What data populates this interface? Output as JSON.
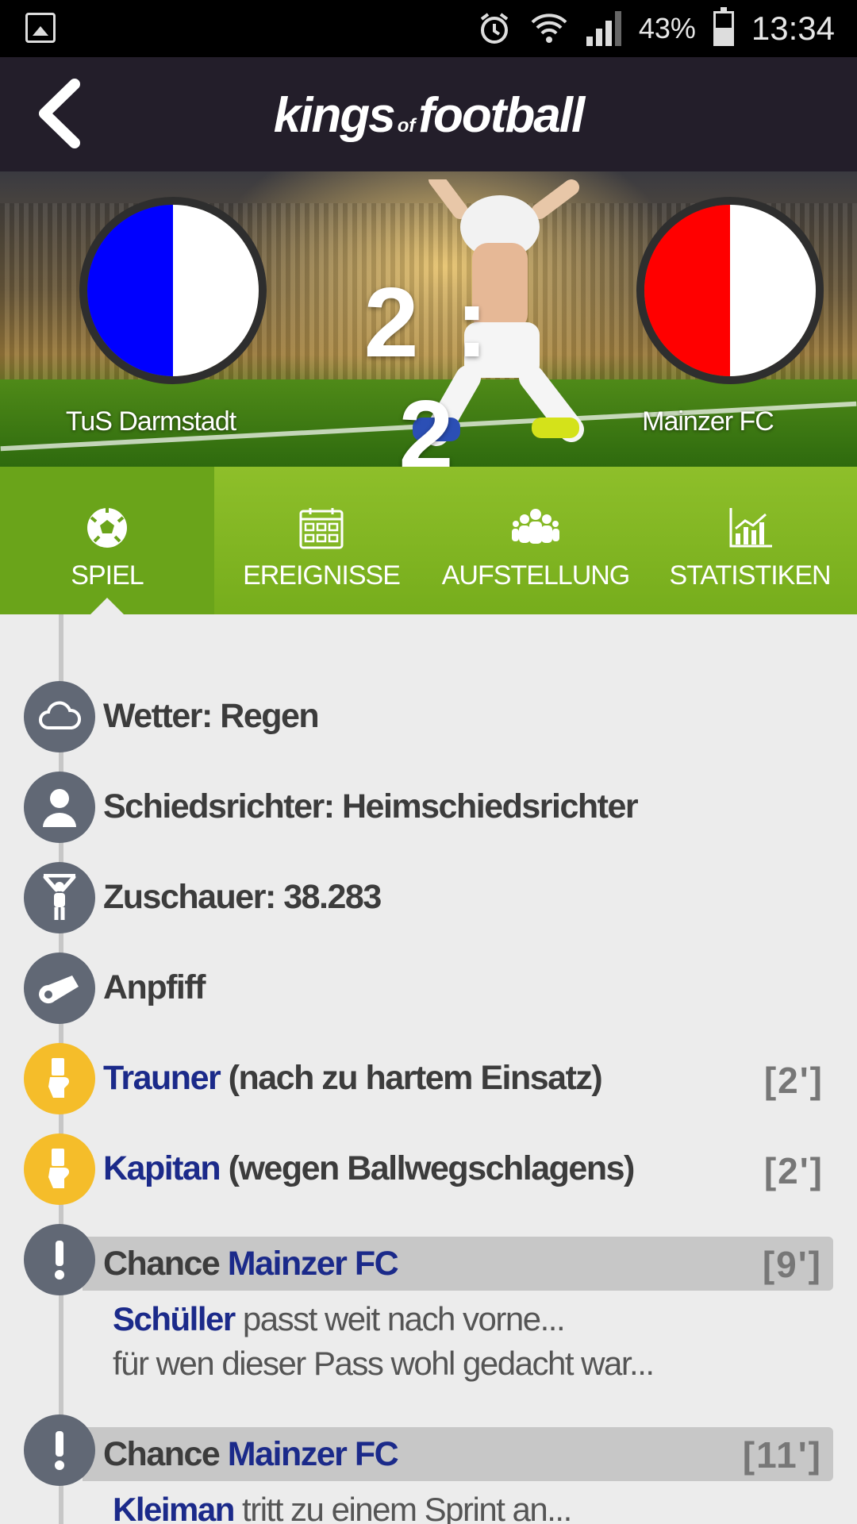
{
  "status_bar": {
    "battery": "43%",
    "time": "13:34"
  },
  "app": {
    "logo_left": "kings",
    "logo_of": "of",
    "logo_right": "football"
  },
  "match": {
    "home_team": "TuS Darmstadt",
    "away_team": "Mainzer FC",
    "score": "2 : 2",
    "home_colors": [
      "#0000ff",
      "#ffffff"
    ],
    "away_colors": [
      "#ff0000",
      "#ffffff"
    ]
  },
  "tabs": [
    {
      "label": "SPIEL",
      "icon": "soccer-ball-icon",
      "active": true
    },
    {
      "label": "EREIGNISSE",
      "icon": "calendar-icon",
      "active": false
    },
    {
      "label": "AUFSTELLUNG",
      "icon": "team-icon",
      "active": false
    },
    {
      "label": "STATISTIKEN",
      "icon": "chart-icon",
      "active": false
    }
  ],
  "info": [
    {
      "icon": "cloud-icon",
      "text": "Wetter: Regen"
    },
    {
      "icon": "referee-icon",
      "text": "Schiedsrichter: Heimschiedsrichter"
    },
    {
      "icon": "fan-icon",
      "text": "Zuschauer: 38.283"
    },
    {
      "icon": "whistle-icon",
      "text": "Anpfiff"
    }
  ],
  "cards": [
    {
      "player": "Trauner",
      "reason": " (nach zu hartem Einsatz)",
      "minute": "[2']"
    },
    {
      "player": "Kapitan",
      "reason": " (wegen Ballwegschlagens)",
      "minute": "[2']"
    }
  ],
  "chances": [
    {
      "label": "Chance ",
      "team": "Mainzer FC",
      "minute": "[9']",
      "player": "Schüller",
      "line1": " passt weit nach vorne...",
      "line2": "für wen dieser Pass wohl gedacht war..."
    },
    {
      "label": "Chance ",
      "team": "Mainzer FC",
      "minute": "[11']",
      "player": "Kleiman",
      "line1": " tritt zu einem Sprint an..."
    }
  ],
  "colors": {
    "topbar": "#231e2a",
    "tab_green": "#7fb523",
    "tab_active": "#6aa41a",
    "event_icon": "#616875",
    "card_yellow": "#f5bd2a",
    "player_blue": "#1b2a8a"
  }
}
